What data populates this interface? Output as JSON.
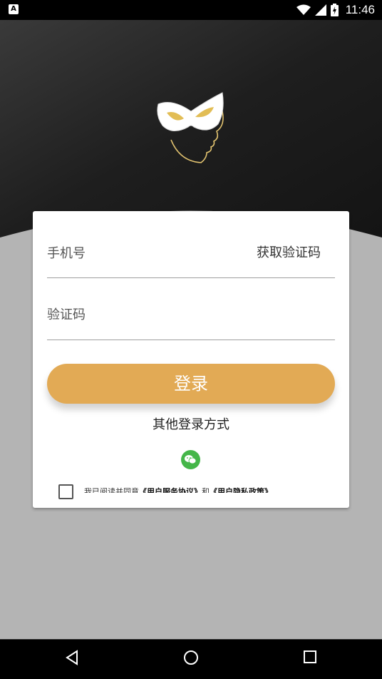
{
  "status_bar": {
    "time": "11:46",
    "notification_icon": "A"
  },
  "colors": {
    "accent": "#e2aa55",
    "hero_bg": "#1e1e1e",
    "page_bg": "#b4b4b4",
    "wechat": "#45b649"
  },
  "form": {
    "phone_label": "手机号",
    "get_code_label": "获取验证码",
    "code_label": "验证码",
    "login_label": "登录",
    "other_login_label": "其他登录方式"
  },
  "agreement": {
    "prefix": "我已阅读并同意",
    "service_link": "《用户服务协议》",
    "and": "和",
    "privacy_link": "《用户隐私政策》"
  },
  "icons": [
    "mask-logo-icon",
    "wechat-icon",
    "back-icon",
    "home-icon",
    "recents-icon",
    "wifi-icon",
    "signal-icon",
    "battery-icon"
  ]
}
